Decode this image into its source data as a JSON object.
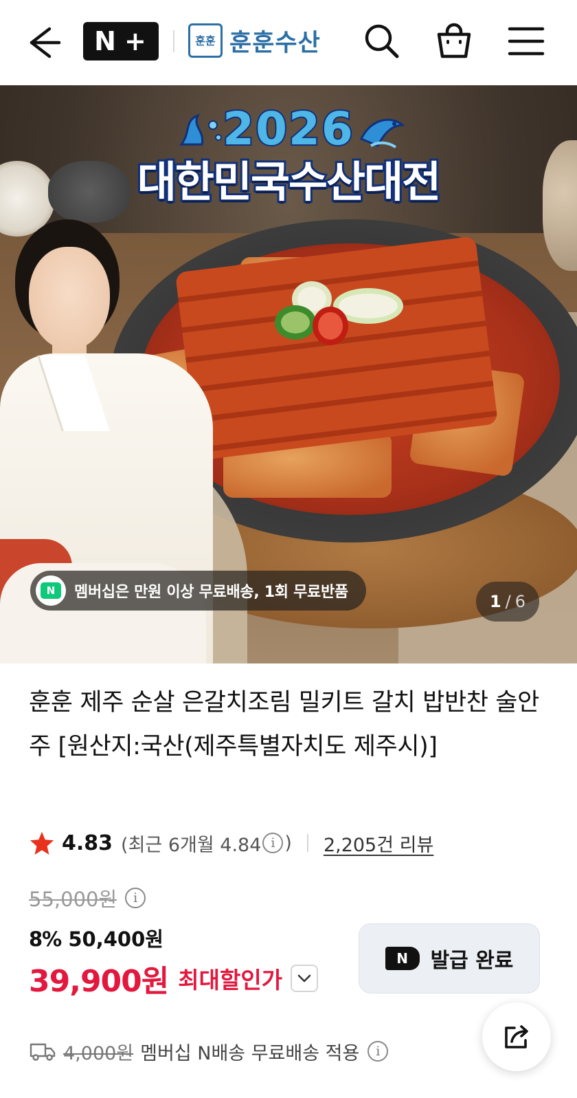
{
  "header": {
    "nplus_label": "N",
    "nplus_plus": "+",
    "brand_logo_text": "훈훈",
    "brand_name": "훈훈수산",
    "icons": [
      "back-arrow-icon",
      "search-icon",
      "shopping-bag-icon",
      "menu-icon"
    ]
  },
  "hero": {
    "event_year": "2026",
    "event_title": "대한민국수산대전",
    "membership_badge": "N",
    "membership_text": "멤버십은 만원 이상 무료배송, 1회 무료반품",
    "counter_current": "1",
    "counter_separator": "/",
    "counter_total": "6"
  },
  "product": {
    "title": "훈훈 제주 순살 은갈치조림 밀키트 갈치 밥반찬 술안주 [원산지:국산(제주특별자치도 제주시)]",
    "rating": "4.83",
    "recent_prefix": "(최근 6개월 4.84",
    "recent_suffix": ")",
    "review_count": "2,205건 리뷰",
    "original_price": "55,000원",
    "discount_percent": "8%",
    "discount_price": "50,400원",
    "final_price": "39,900원",
    "final_label": "최대할인가",
    "coupon_badge": "N",
    "coupon_button": "발급 완료",
    "shipping_original": "4,000원",
    "shipping_text": "멤버십 N배송 무료배송 적용"
  },
  "colors": {
    "accent_red": "#e2183e",
    "brand_blue": "#2b6fa5",
    "naver_green": "#0ec97a"
  }
}
